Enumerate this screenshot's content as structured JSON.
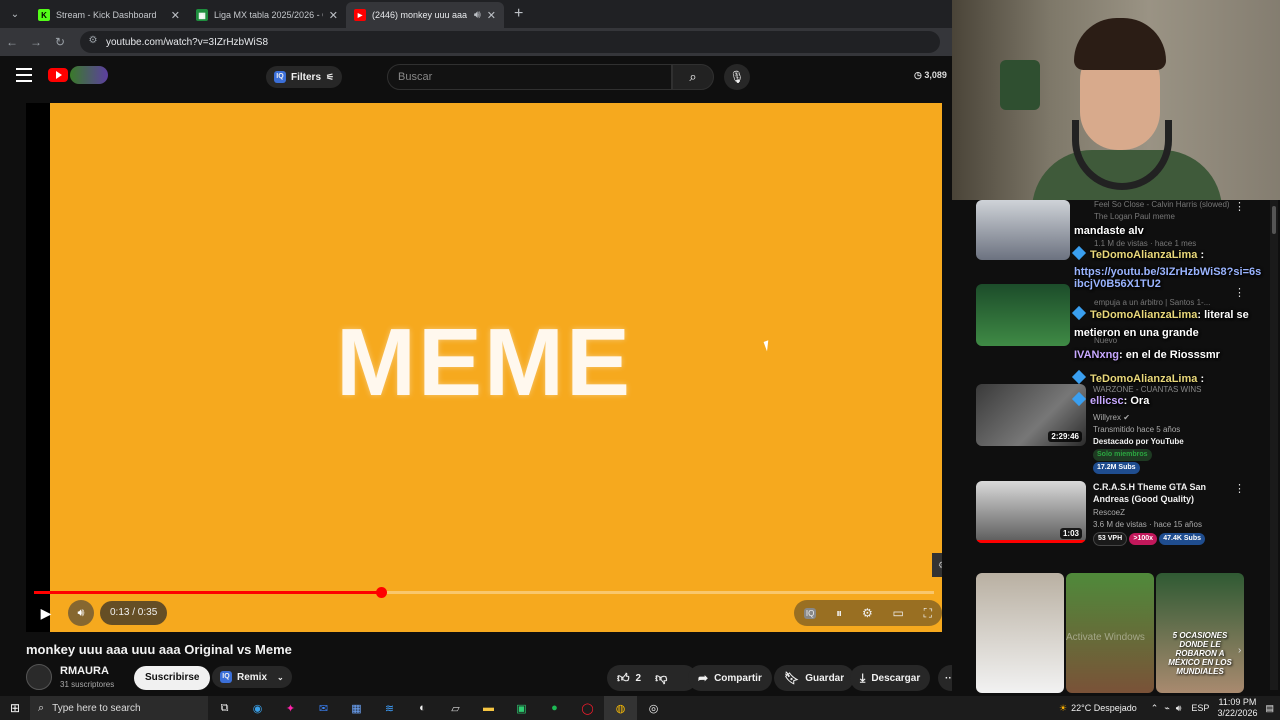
{
  "tabs": [
    {
      "title": "Stream - Kick Dashboard",
      "favicon": "kick-icon",
      "color": "#53fc18",
      "active": false
    },
    {
      "title": "Liga MX tabla 2025/2026 - Cla",
      "favicon": "sheets-icon",
      "color": "#1e8e3e",
      "active": false
    },
    {
      "title": "(2446) monkey uuu aaa uu",
      "favicon": "youtube-icon",
      "color": "#ff0000",
      "active": true
    }
  ],
  "address": {
    "url": "youtube.com/watch?v=3IZrHzbWiS8"
  },
  "youtube": {
    "filters_label": "Filters",
    "search_placeholder": "Buscar",
    "view_count": "3,089",
    "video_text": "MEME",
    "time": "0:13 / 0:35",
    "progress": 0.386,
    "title": "monkey uuu aaa uuu aaa Original vs Meme",
    "channel": "RMAURA",
    "subscribers": "31 suscriptores",
    "subscribe_label": "Suscribirse",
    "remix_label": "Remix",
    "likes": "2",
    "share_label": "Compartir",
    "save_label": "Guardar",
    "download_label": "Descargar"
  },
  "sidebar": {
    "items": [
      {
        "title": "Feel So Close - Calvin Harris (slowed) The Logan Paul meme",
        "meta": "1.1 M de vistas · hace 1 mes"
      },
      {
        "title": "empuja a un árbitro | Santos 1-...",
        "meta": "Nuevo"
      },
      {
        "title": "WARZONE - CUANTAS WINS",
        "channel": "Willyrex",
        "meta": "Transmitido hace 5 años",
        "featured": "Destacado por YouTube",
        "members": "Solo miembros",
        "subs": "17.2M Subs",
        "duration": "2:29:46"
      },
      {
        "title": "C.R.A.S.H Theme GTA San Andreas (Good Quality)",
        "channel": "RescoeZ",
        "meta": "3.6 M de vistas · hace 15 años",
        "vph": "53 VPH",
        "ratio": ">100x",
        "subs": "47.4K Subs",
        "duration": "1:03"
      }
    ],
    "shorts_caption": "5 OCASIONES DONDE LE ROBARON A MÉXICO EN LOS MUNDIALES"
  },
  "chat": [
    {
      "user": "",
      "text": "mandaste alv"
    },
    {
      "user": "TeDomoAlianzaLima",
      "text": ":"
    },
    {
      "user": "",
      "text": "https://youtu.be/3IZrHzbWiS8?si=6sibcjV0B56X1TU2"
    },
    {
      "user": "TeDomoAlianzaLima",
      "text": ": literal se"
    },
    {
      "user": "",
      "text": "metieron en una grande"
    },
    {
      "user": "IVANxng",
      "text": ": en el de Riosssmr"
    },
    {
      "user": "TeDomoAlianzaLima",
      "text": ":"
    },
    {
      "user": "ellicsc",
      "text": ": Ora"
    }
  ],
  "activate_text": "Activate Windows",
  "taskbar": {
    "search_placeholder": "Type here to search",
    "weather": "22°C  Despejado",
    "lang": "ESP",
    "time": "11:09 PM",
    "date": "3/22/2026"
  }
}
